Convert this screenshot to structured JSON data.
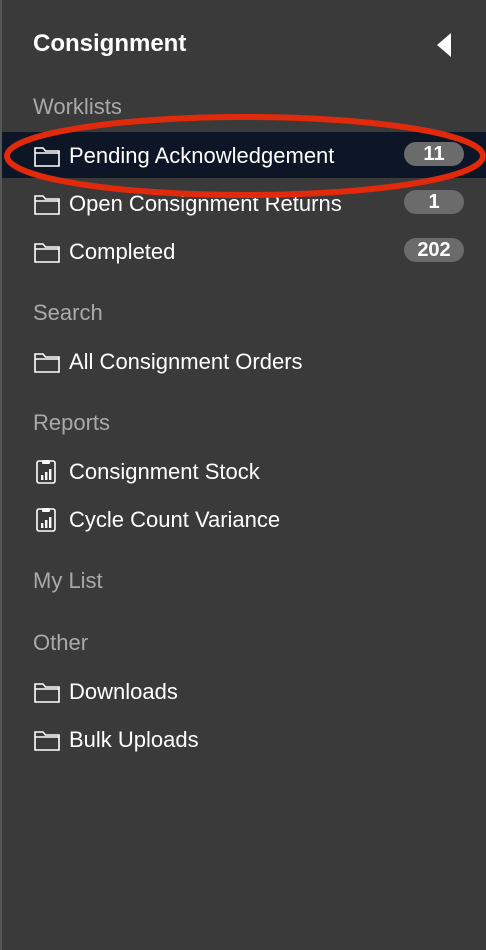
{
  "panel": {
    "title": "Consignment"
  },
  "sections": {
    "worklists": {
      "title": "Worklists",
      "items": [
        {
          "label": "Pending Acknowledgement",
          "count": "11"
        },
        {
          "label": "Open Consignment Returns",
          "count": "1"
        },
        {
          "label": "Completed",
          "count": "202"
        }
      ]
    },
    "search": {
      "title": "Search",
      "items": [
        {
          "label": "All Consignment Orders"
        }
      ]
    },
    "reports": {
      "title": "Reports",
      "items": [
        {
          "label": "Consignment Stock"
        },
        {
          "label": "Cycle Count Variance"
        }
      ]
    },
    "mylist": {
      "title": "My List"
    },
    "other": {
      "title": "Other",
      "items": [
        {
          "label": "Downloads"
        },
        {
          "label": "Bulk Uploads"
        }
      ]
    }
  },
  "colors": {
    "panel_bg": "#3a3a3a",
    "active_bg": "#0c1626",
    "badge_bg": "#6b6b6b",
    "section_title": "#a9a9a9",
    "annotation_ring": "#e12a0c"
  },
  "icons": {
    "folder": "folder-icon",
    "report": "report-chart-icon",
    "collapse": "collapse-left-triangle-icon"
  }
}
